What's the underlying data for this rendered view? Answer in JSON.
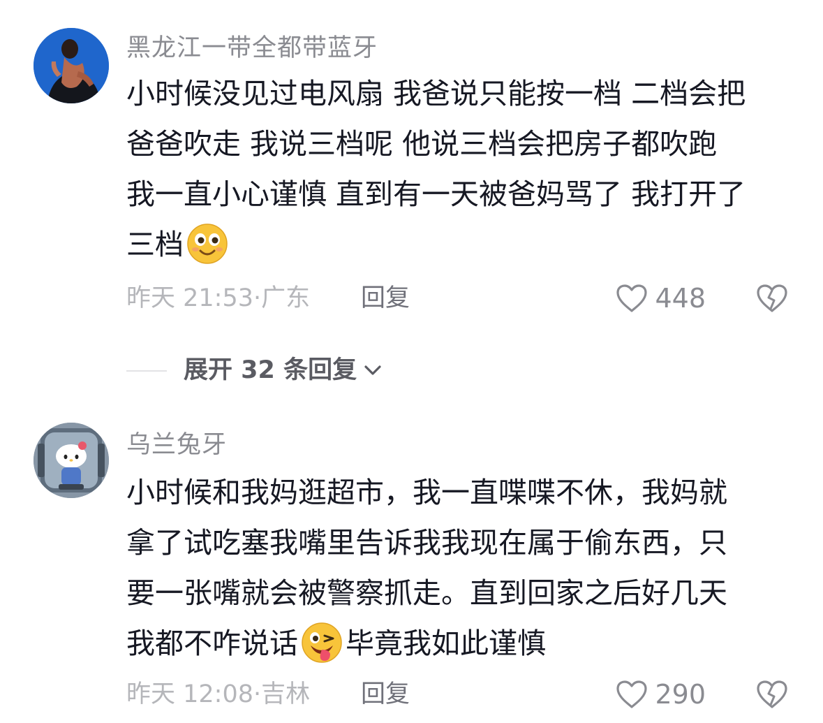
{
  "comments": [
    {
      "username": "黑龙江一带全都带蓝牙",
      "lines": [
        "小时候没见过电风扇 我爸说只能按一档 二档会把",
        "爸爸吹走 我说三档呢 他说三档会把房子都吹跑",
        "我一直小心谨慎 直到有一天被爸妈骂了 我打开了",
        "三档"
      ],
      "emoji": "smiling-face-emoji",
      "time": "昨天 21:53·",
      "location": "广东",
      "reply_label": "回复",
      "likes": "448",
      "expand_label": "展开 32 条回复"
    },
    {
      "username": "乌兰兔牙",
      "lines": [
        "小时候和我妈逛超市，我一直喋喋不休，我妈就",
        "拿了试吃塞我嘴里告诉我我现在属于偷东西，只",
        "要一张嘴就会被警察抓走。直到回家之后好几天"
      ],
      "line4_prefix": "我都不咋说话",
      "line4_suffix": "毕竟我如此谨慎",
      "emoji": "winking-tongue-face-emoji",
      "time": "昨天 12:08·",
      "location": "吉林",
      "reply_label": "回复",
      "likes": "290"
    }
  ],
  "colors": {
    "text": "#161823",
    "username": "#8a8b91",
    "meta": "#b5b6ba",
    "icon": "#8a8b91",
    "emoji": "#f8c43a"
  }
}
